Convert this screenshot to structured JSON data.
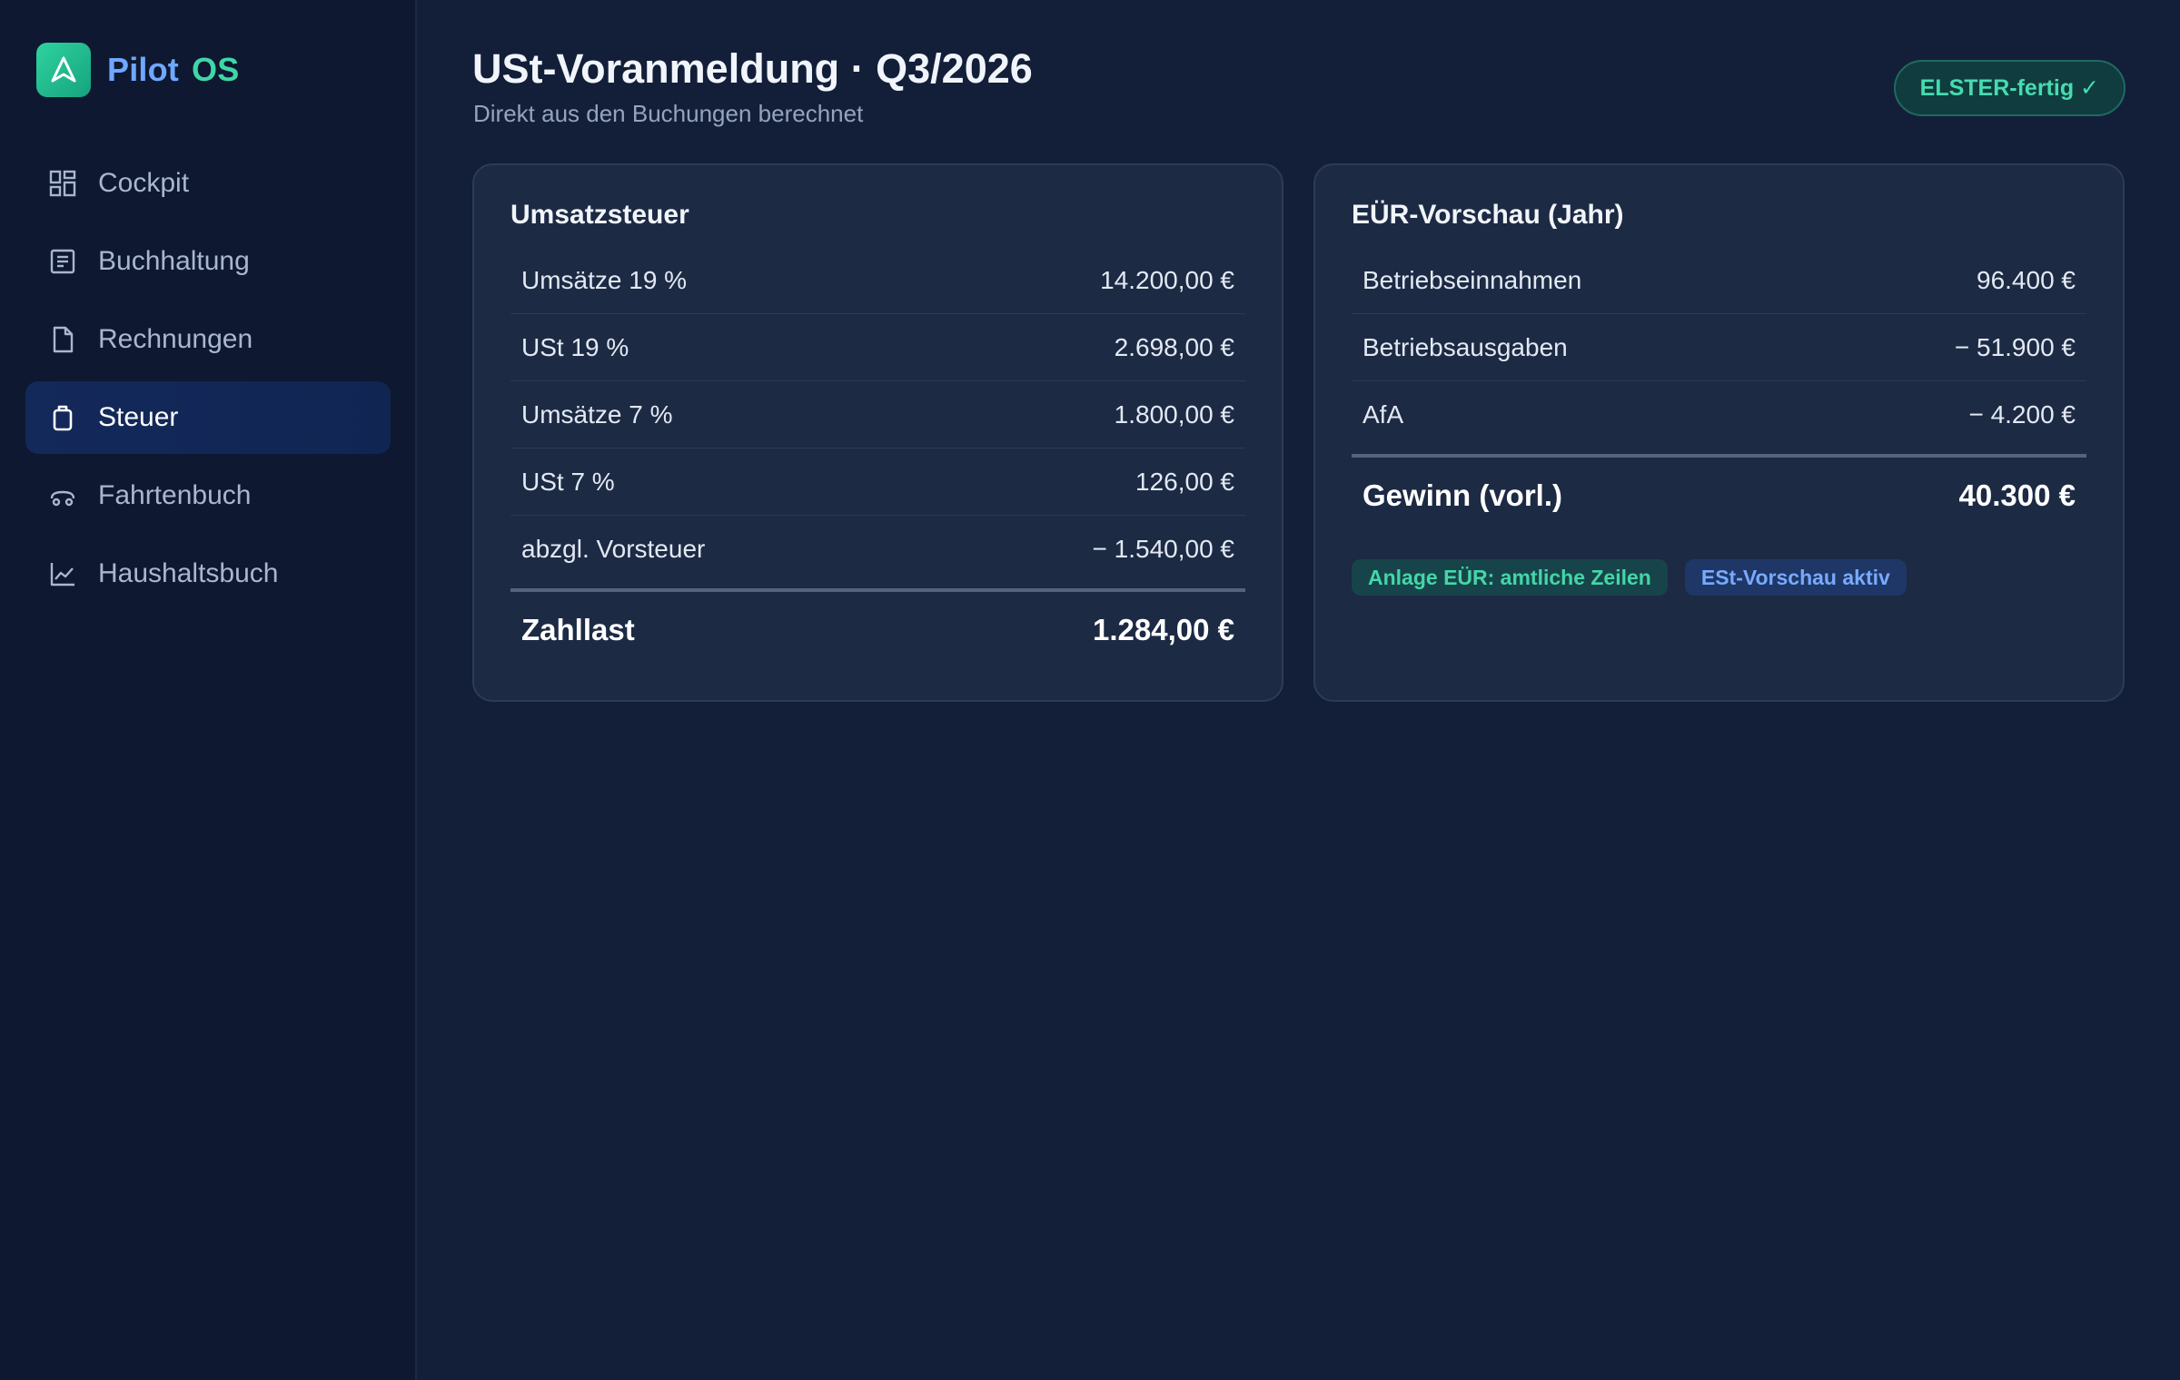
{
  "brand": {
    "name_part1": "Pilot",
    "name_part2": "OS",
    "logo_icon": "navigation-arrow-icon"
  },
  "nav": {
    "items": [
      {
        "label": "Cockpit",
        "icon": "dashboard-grid-icon",
        "active": false
      },
      {
        "label": "Buchhaltung",
        "icon": "ledger-document-icon",
        "active": false
      },
      {
        "label": "Rechnungen",
        "icon": "invoice-file-icon",
        "active": false
      },
      {
        "label": "Steuer",
        "icon": "tax-clipboard-icon",
        "active": true
      },
      {
        "label": "Fahrtenbuch",
        "icon": "car-icon",
        "active": false
      },
      {
        "label": "Haushaltsbuch",
        "icon": "line-chart-icon",
        "active": false
      }
    ]
  },
  "header": {
    "title": "USt-Voranmeldung · Q3/2026",
    "subtitle": "Direkt aus den Buchungen berechnet",
    "status_badge": "ELSTER-fertig ✓"
  },
  "vat_card": {
    "title": "Umsatzsteuer",
    "rows": [
      {
        "label": "Umsätze 19 %",
        "value": "14.200,00 €"
      },
      {
        "label": "USt 19 %",
        "value": "2.698,00 €"
      },
      {
        "label": "Umsätze 7 %",
        "value": "1.800,00 €"
      },
      {
        "label": "USt 7 %",
        "value": "126,00 €"
      },
      {
        "label": "abzgl. Vorsteuer",
        "value": "− 1.540,00 €"
      }
    ],
    "total": {
      "label": "Zahllast",
      "value": "1.284,00 €"
    }
  },
  "eur_card": {
    "title": "EÜR-Vorschau (Jahr)",
    "rows": [
      {
        "label": "Betriebseinnahmen",
        "value": "96.400 €"
      },
      {
        "label": "Betriebsausgaben",
        "value": "− 51.900 €"
      },
      {
        "label": "AfA",
        "value": "− 4.200 €"
      }
    ],
    "total": {
      "label": "Gewinn (vorl.)",
      "value": "40.300 €"
    },
    "chips": [
      {
        "label": "Anlage EÜR: amtliche Zeilen"
      },
      {
        "label": "ESt-Vorschau aktiv"
      }
    ]
  },
  "colors": {
    "accent_green": "#3fd6a8",
    "accent_blue": "#6fa8ff",
    "background": "#131f38",
    "sidebar": "#0e1830",
    "card": "#1c2a44"
  }
}
